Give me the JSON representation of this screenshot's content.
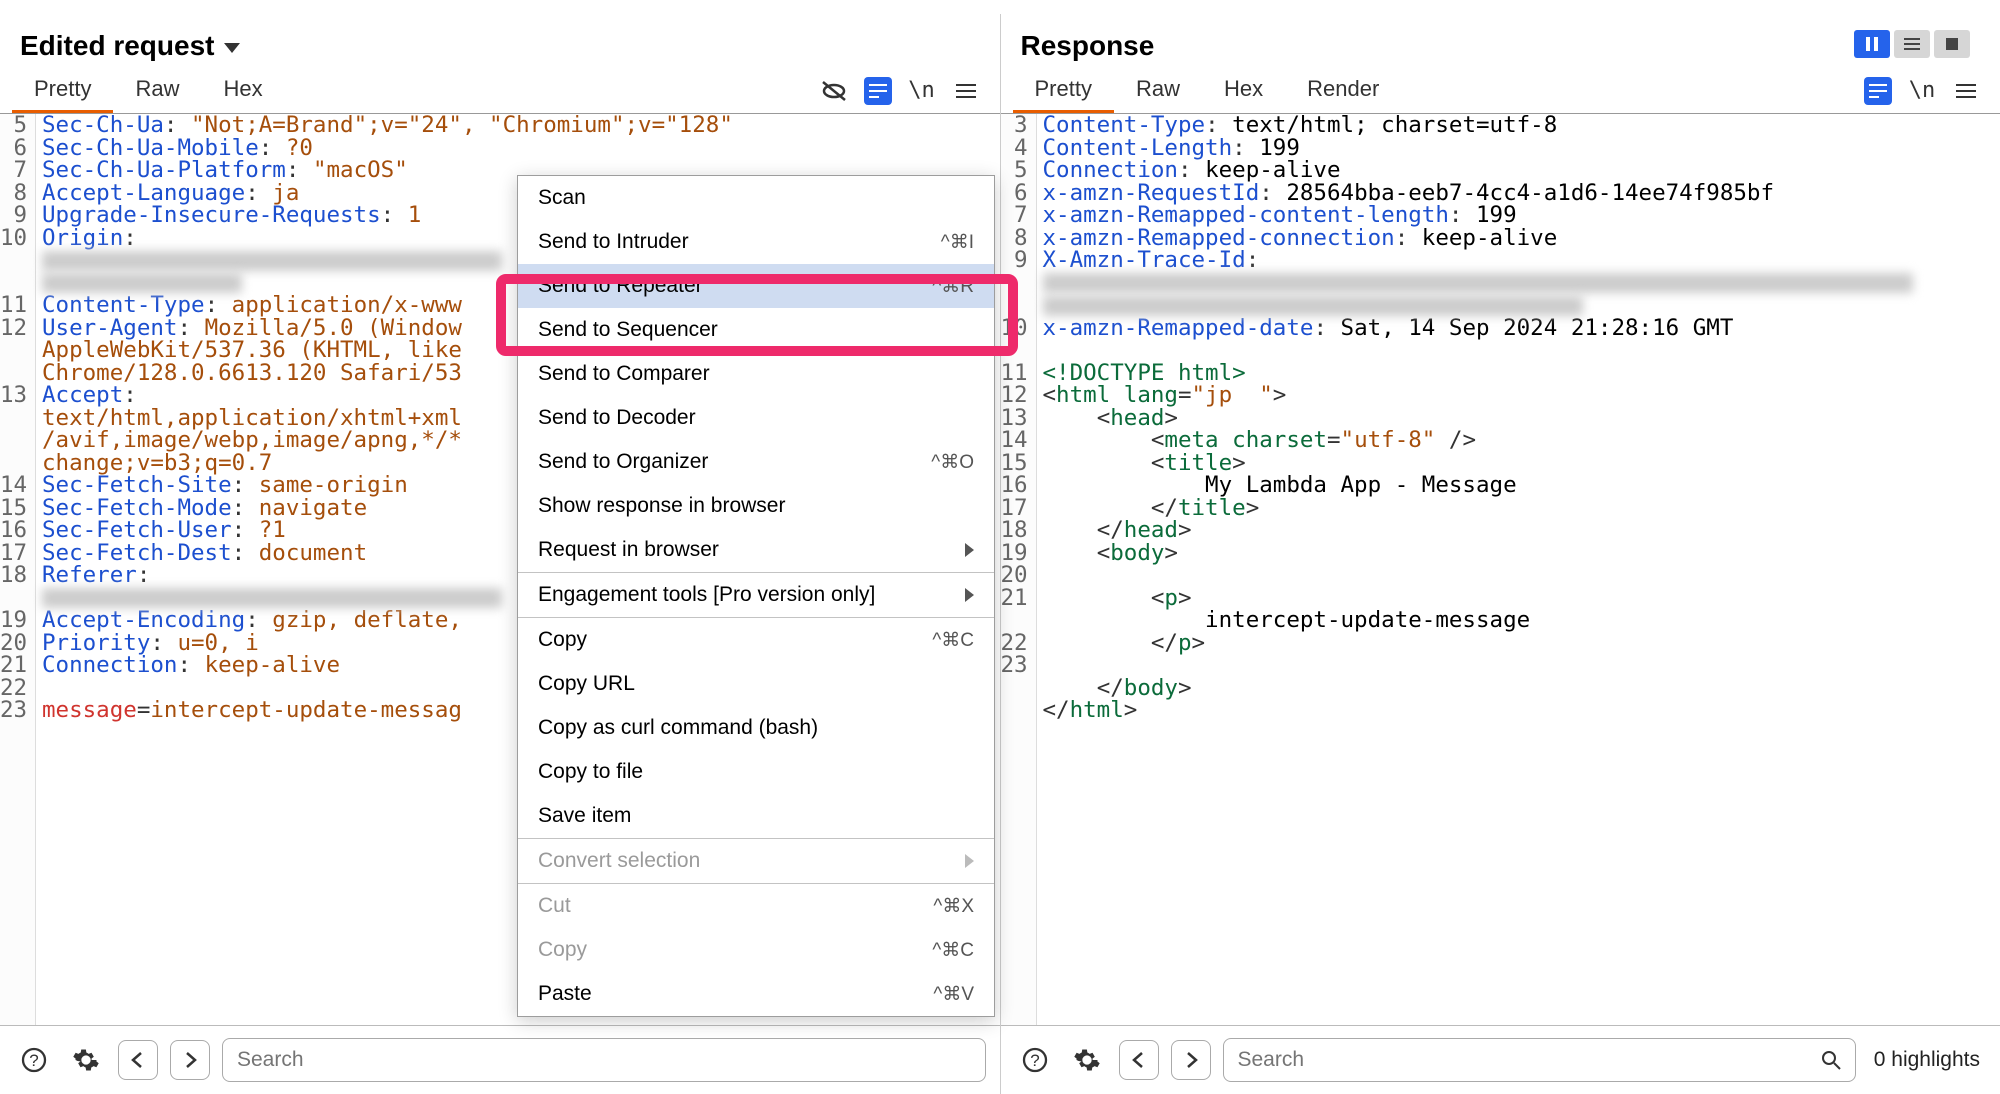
{
  "top": {
    "pause": "⏸",
    "list": "≡",
    "stop": "■"
  },
  "request": {
    "title": "Edited request",
    "tabs": [
      "Pretty",
      "Raw",
      "Hex"
    ],
    "active_tab": 0,
    "line_numbers": [
      5,
      6,
      7,
      8,
      9,
      10,
      "",
      "",
      11,
      12,
      "",
      "",
      13,
      "",
      "",
      "",
      14,
      15,
      16,
      17,
      18,
      "",
      19,
      20,
      21,
      22,
      23
    ],
    "lines": [
      [
        [
          "hdr",
          "Sec-Ch-Ua"
        ],
        [
          "punct",
          ": "
        ],
        [
          "str",
          "\"Not;A=Brand\";v=\"24\", \"Chromium\";v=\"128\""
        ]
      ],
      [
        [
          "hdr",
          "Sec-Ch-Ua-Mobile"
        ],
        [
          "punct",
          ": "
        ],
        [
          "str",
          "?0"
        ]
      ],
      [
        [
          "hdr",
          "Sec-Ch-Ua-Platform"
        ],
        [
          "punct",
          ": "
        ],
        [
          "str",
          "\"macOS\""
        ]
      ],
      [
        [
          "hdr",
          "Accept-Language"
        ],
        [
          "punct",
          ": "
        ],
        [
          "str",
          "ja"
        ]
      ],
      [
        [
          "hdr",
          "Upgrade-Insecure-Requests"
        ],
        [
          "punct",
          ": "
        ],
        [
          "str",
          "1"
        ]
      ],
      [
        [
          "hdr",
          "Origin"
        ],
        [
          "punct",
          ": "
        ]
      ],
      [
        [
          "blur",
          ""
        ]
      ],
      [
        [
          "blurshort",
          ""
        ]
      ],
      [
        [
          "hdr",
          "Content-Type"
        ],
        [
          "punct",
          ": "
        ],
        [
          "str",
          "application/x-www"
        ]
      ],
      [
        [
          "hdr",
          "User-Agent"
        ],
        [
          "punct",
          ": "
        ],
        [
          "str",
          "Mozilla/5.0 (Window"
        ]
      ],
      [
        [
          "str",
          "AppleWebKit/537.36 (KHTML, like"
        ]
      ],
      [
        [
          "str",
          "Chrome/128.0.6613.120 Safari/53"
        ]
      ],
      [
        [
          "hdr",
          "Accept"
        ],
        [
          "punct",
          ": "
        ]
      ],
      [
        [
          "str",
          "text/html,application/xhtml+xml"
        ]
      ],
      [
        [
          "str",
          "/avif,image/webp,image/apng,*/*"
        ]
      ],
      [
        [
          "str",
          "change;v=b3;q=0.7"
        ]
      ],
      [
        [
          "hdr",
          "Sec-Fetch-Site"
        ],
        [
          "punct",
          ": "
        ],
        [
          "str",
          "same-origin"
        ]
      ],
      [
        [
          "hdr",
          "Sec-Fetch-Mode"
        ],
        [
          "punct",
          ": "
        ],
        [
          "str",
          "navigate"
        ]
      ],
      [
        [
          "hdr",
          "Sec-Fetch-User"
        ],
        [
          "punct",
          ": "
        ],
        [
          "str",
          "?1"
        ]
      ],
      [
        [
          "hdr",
          "Sec-Fetch-Dest"
        ],
        [
          "punct",
          ": "
        ],
        [
          "str",
          "document"
        ]
      ],
      [
        [
          "hdr",
          "Referer"
        ],
        [
          "punct",
          ": "
        ]
      ],
      [
        [
          "blur",
          ""
        ]
      ],
      [
        [
          "hdr",
          "Accept-Encoding"
        ],
        [
          "punct",
          ": "
        ],
        [
          "str",
          "gzip, deflate,"
        ]
      ],
      [
        [
          "hdr",
          "Priority"
        ],
        [
          "punct",
          ": "
        ],
        [
          "str",
          "u=0, i"
        ]
      ],
      [
        [
          "hdr",
          "Connection"
        ],
        [
          "punct",
          ": "
        ],
        [
          "str",
          "keep-alive"
        ]
      ],
      [
        [
          "",
          ""
        ]
      ],
      [
        [
          "param",
          "message"
        ],
        [
          "punct",
          "="
        ],
        [
          "str",
          "intercept-update-messag"
        ]
      ]
    ],
    "search_placeholder": "Search",
    "highlights": "0 highlights"
  },
  "response": {
    "title": "Response",
    "tabs": [
      "Pretty",
      "Raw",
      "Hex",
      "Render"
    ],
    "active_tab": 0,
    "line_numbers": [
      3,
      4,
      5,
      6,
      7,
      8,
      9,
      "",
      "",
      10,
      "",
      11,
      12,
      13,
      14,
      15,
      16,
      17,
      18,
      19,
      20,
      21,
      "",
      22,
      23
    ],
    "lines": [
      [
        [
          "hdr",
          "Content-Type"
        ],
        [
          "punct",
          ": "
        ],
        [
          "",
          "text/html; charset=utf-8"
        ]
      ],
      [
        [
          "hdr",
          "Content-Length"
        ],
        [
          "punct",
          ": "
        ],
        [
          "",
          "199"
        ]
      ],
      [
        [
          "hdr",
          "Connection"
        ],
        [
          "punct",
          ": "
        ],
        [
          "",
          "keep-alive"
        ]
      ],
      [
        [
          "hdr",
          "x-amzn-RequestId"
        ],
        [
          "punct",
          ": "
        ],
        [
          "",
          "28564bba-eeb7-4cc4-a1d6-14ee74f985bf"
        ]
      ],
      [
        [
          "hdr",
          "x-amzn-Remapped-content-length"
        ],
        [
          "punct",
          ": "
        ],
        [
          "",
          "199"
        ]
      ],
      [
        [
          "hdr",
          "x-amzn-Remapped-connection"
        ],
        [
          "punct",
          ": "
        ],
        [
          "",
          "keep-alive"
        ]
      ],
      [
        [
          "hdr",
          "X-Amzn-Trace-Id"
        ],
        [
          "punct",
          ": "
        ]
      ],
      [
        [
          "blurr1",
          ""
        ]
      ],
      [
        [
          "blurr2",
          ""
        ]
      ],
      [
        [
          "hdr",
          "x-amzn-Remapped-date"
        ],
        [
          "punct",
          ": "
        ],
        [
          "",
          "Sat, 14 Sep 2024 21:28:16 GMT"
        ]
      ],
      [
        [
          "",
          ""
        ]
      ],
      [
        [
          "dir",
          "<!DOCTYPE html>"
        ]
      ],
      [
        [
          "punct",
          "<"
        ],
        [
          "tagc",
          "html"
        ],
        [
          "",
          " "
        ],
        [
          "attr",
          "lang"
        ],
        [
          "punct",
          "="
        ],
        [
          "str",
          "\"jp  \""
        ],
        [
          "punct",
          ">"
        ]
      ],
      [
        [
          "",
          "    "
        ],
        [
          "punct",
          "<"
        ],
        [
          "tagc",
          "head"
        ],
        [
          "punct",
          ">"
        ]
      ],
      [
        [
          "",
          "        "
        ],
        [
          "punct",
          "<"
        ],
        [
          "tagc",
          "meta"
        ],
        [
          "",
          " "
        ],
        [
          "attr",
          "charset"
        ],
        [
          "punct",
          "="
        ],
        [
          "str",
          "\"utf-8\""
        ],
        [
          "punct",
          " />"
        ]
      ],
      [
        [
          "",
          "        "
        ],
        [
          "punct",
          "<"
        ],
        [
          "tagc",
          "title"
        ],
        [
          "punct",
          ">"
        ]
      ],
      [
        [
          "",
          "            My Lambda App - Message"
        ]
      ],
      [
        [
          "",
          "        "
        ],
        [
          "punct",
          "</"
        ],
        [
          "tagc",
          "title"
        ],
        [
          "punct",
          ">"
        ]
      ],
      [
        [
          "",
          "    "
        ],
        [
          "punct",
          "</"
        ],
        [
          "tagc",
          "head"
        ],
        [
          "punct",
          ">"
        ]
      ],
      [
        [
          "",
          "    "
        ],
        [
          "punct",
          "<"
        ],
        [
          "tagc",
          "body"
        ],
        [
          "punct",
          ">"
        ]
      ],
      [
        [
          "",
          "        "
        ]
      ],
      [
        [
          "",
          "        "
        ],
        [
          "punct",
          "<"
        ],
        [
          "tagc",
          "p"
        ],
        [
          "punct",
          ">"
        ]
      ],
      [
        [
          "",
          "            intercept-update-message"
        ]
      ],
      [
        [
          "",
          "        "
        ],
        [
          "punct",
          "</"
        ],
        [
          "tagc",
          "p"
        ],
        [
          "punct",
          ">"
        ]
      ],
      [
        [
          "",
          ""
        ]
      ],
      [
        [
          "",
          "    "
        ],
        [
          "punct",
          "</"
        ],
        [
          "tagc",
          "body"
        ],
        [
          "punct",
          ">"
        ]
      ],
      [
        [
          "punct",
          "</"
        ],
        [
          "tagc",
          "html"
        ],
        [
          "punct",
          ">"
        ]
      ]
    ],
    "search_placeholder": "Search",
    "highlights": "0 highlights"
  },
  "context_menu": {
    "items": [
      {
        "label": "Scan",
        "shortcut": "",
        "kind": "normal"
      },
      {
        "label": "Send to Intruder",
        "shortcut": "^⌘I",
        "kind": "normal"
      },
      {
        "label": "Send to Repeater",
        "shortcut": "^⌘R",
        "kind": "highlight"
      },
      {
        "label": "Send to Sequencer",
        "shortcut": "",
        "kind": "normal"
      },
      {
        "label": "Send to Comparer",
        "shortcut": "",
        "kind": "normal"
      },
      {
        "label": "Send to Decoder",
        "shortcut": "",
        "kind": "normal"
      },
      {
        "label": "Send to Organizer",
        "shortcut": "^⌘O",
        "kind": "normal"
      },
      {
        "label": "Show response in browser",
        "shortcut": "",
        "kind": "normal"
      },
      {
        "label": "Request in browser",
        "shortcut": "",
        "kind": "submenu"
      },
      {
        "sep": true
      },
      {
        "label": "Engagement tools [Pro version only]",
        "shortcut": "",
        "kind": "submenu"
      },
      {
        "sep": true
      },
      {
        "label": "Copy",
        "shortcut": "^⌘C",
        "kind": "normal"
      },
      {
        "label": "Copy URL",
        "shortcut": "",
        "kind": "normal"
      },
      {
        "label": "Copy as curl command (bash)",
        "shortcut": "",
        "kind": "normal"
      },
      {
        "label": "Copy to file",
        "shortcut": "",
        "kind": "normal"
      },
      {
        "label": "Save item",
        "shortcut": "",
        "kind": "normal"
      },
      {
        "sep": true
      },
      {
        "label": "Convert selection",
        "shortcut": "",
        "kind": "submenu-disabled"
      },
      {
        "sep": true
      },
      {
        "label": "Cut",
        "shortcut": "^⌘X",
        "kind": "disabled"
      },
      {
        "label": "Copy",
        "shortcut": "^⌘C",
        "kind": "disabled"
      },
      {
        "label": "Paste",
        "shortcut": "^⌘V",
        "kind": "normal"
      }
    ]
  }
}
